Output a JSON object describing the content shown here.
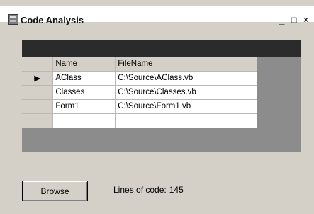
{
  "window": {
    "title": "Code Analysis",
    "icon": "app-window-icon",
    "caption_buttons": [
      {
        "name": "minimize",
        "glyph": "_"
      },
      {
        "name": "maximize",
        "glyph": "□"
      },
      {
        "name": "close",
        "glyph": "×"
      }
    ]
  },
  "grid": {
    "columns": [
      "Name",
      "FileName"
    ],
    "rows": [
      {
        "current": true,
        "indicator": "▶",
        "name": "AClass",
        "file": "C:\\Source\\AClass.vb"
      },
      {
        "current": false,
        "indicator": "",
        "name": "Classes",
        "file": "C:\\Source\\Classes.vb"
      },
      {
        "current": false,
        "indicator": "",
        "name": "Form1",
        "file": "C:\\Source\\Form1.vb"
      }
    ]
  },
  "footer": {
    "browse_label": "Browse",
    "loc_label": "Lines of code:",
    "loc_value": "145"
  }
}
